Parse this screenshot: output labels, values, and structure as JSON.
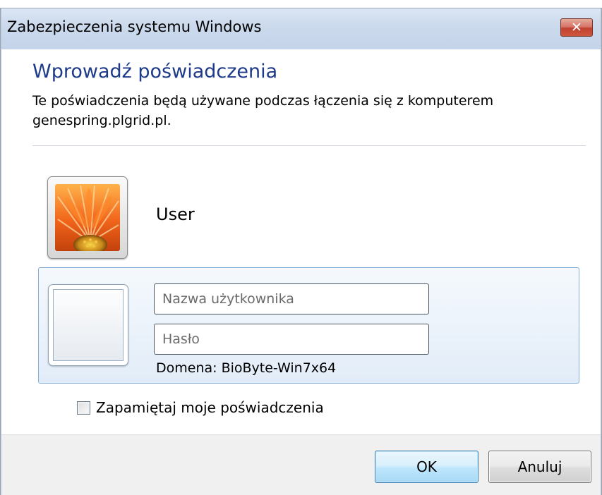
{
  "window": {
    "title": "Zabezpieczenia systemu Windows",
    "close_symbol": "✕"
  },
  "dialog": {
    "heading": "Wprowadź poświadczenia",
    "description_line1": "Te poświadczenia będą używane podczas łączenia się z komputerem",
    "description_line2": "genespring.plgrid.pl."
  },
  "saved_user": {
    "name": "User",
    "tile_icon": "flower-avatar-icon"
  },
  "new_credentials": {
    "tile_icon": "blank-user-tile-icon",
    "username_placeholder": "Nazwa użytkownika",
    "username_value": "",
    "password_placeholder": "Hasło",
    "password_value": "",
    "domain_text": "Domena: BioByte-Win7x64"
  },
  "remember": {
    "label": "Zapamiętaj moje poświadczenia",
    "checked": false
  },
  "buttons": {
    "ok_label": "OK",
    "cancel_label": "Anuluj"
  },
  "colors": {
    "heading": "#1e3a8a",
    "selection_border": "#84acd6",
    "ok_button_border": "#3c7fb1",
    "close_button": "#c0412f"
  }
}
